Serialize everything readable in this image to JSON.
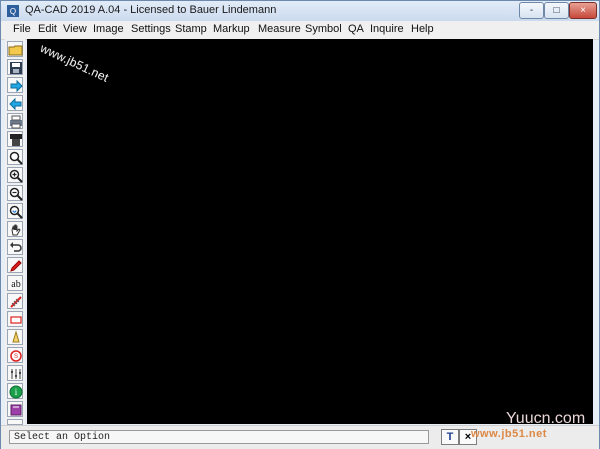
{
  "window": {
    "title": "QA-CAD 2019 A.04 - Licensed to Bauer Lindemann",
    "controls": {
      "minimize": "-",
      "maximize": "□",
      "close": "×"
    }
  },
  "menu": {
    "items": [
      "File",
      "Edit",
      "View",
      "Image",
      "Settings",
      "Stamp",
      "Markup",
      "Measure",
      "Symbol",
      "QA",
      "Inquire",
      "Help"
    ]
  },
  "toolbar": {
    "icons": [
      "open-folder-icon",
      "save-icon",
      "forward-icon",
      "back-icon",
      "print-icon",
      "plotter-icon",
      "zoom-icon",
      "zoom-in-icon",
      "zoom-out-icon",
      "zoom-refresh-icon",
      "pan-hand-icon",
      "undo-icon",
      "pencil-icon",
      "text-ab-icon",
      "measure-ruler-icon",
      "rectangle-icon",
      "pen-icon",
      "stamp-icon",
      "settings-sliders-icon",
      "info-icon",
      "book-icon",
      "help-icon"
    ]
  },
  "status": {
    "text": "Select an Option",
    "btn_t": "T",
    "btn_x": "×"
  },
  "watermarks": {
    "left": "www.jb51.net",
    "right": "www.jb51.net",
    "yucun": "Yuucn.com"
  }
}
